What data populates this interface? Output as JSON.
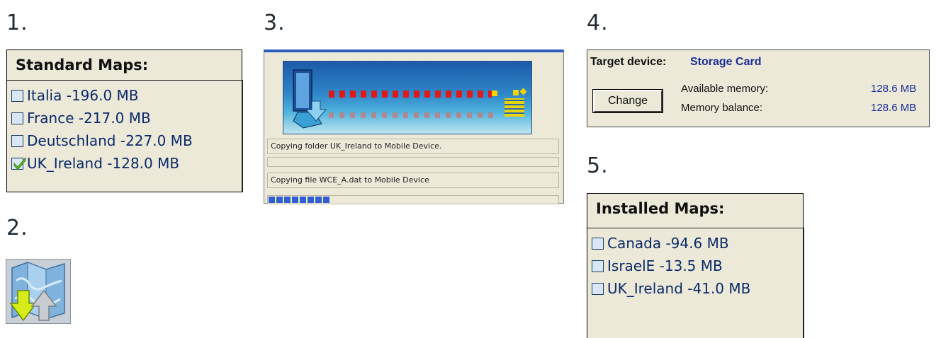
{
  "steps": [
    "1.",
    "2.",
    "3.",
    "4.",
    "5."
  ],
  "standard_maps": {
    "title": "Standard Maps:",
    "items": [
      {
        "name": "Italia -196.0 MB",
        "checked": false
      },
      {
        "name": "France -217.0 MB",
        "checked": false
      },
      {
        "name": "Deutschland -227.0 MB",
        "checked": false
      },
      {
        "name": "UK_Ireland -128.0 MB",
        "checked": true
      }
    ]
  },
  "copy_dialog": {
    "folder_status": "Copying folder UK_Ireland to Mobile Device.",
    "file_status": "Copying file WCE_A.dat to Mobile Device",
    "progress_fraction": 0.21
  },
  "target_device": {
    "label": "Target device:",
    "value": "Storage Card",
    "change_button": "Change",
    "available_label": "Available memory:",
    "available_value": "128.6 MB",
    "balance_label": "Memory balance:",
    "balance_value": "128.6 MB"
  },
  "installed_maps": {
    "title": "Installed Maps:",
    "items": [
      {
        "name": "Canada -94.6 MB",
        "checked": false
      },
      {
        "name": "IsraelE -13.5 MB",
        "checked": false
      },
      {
        "name": "UK_Ireland -41.0 MB",
        "checked": false
      }
    ]
  },
  "colors": {
    "panel_bg": "#ece9d8",
    "link_blue": "#1a2c9a",
    "progress_blue": "#2f5fd0",
    "check_green": "#5cb82a"
  }
}
